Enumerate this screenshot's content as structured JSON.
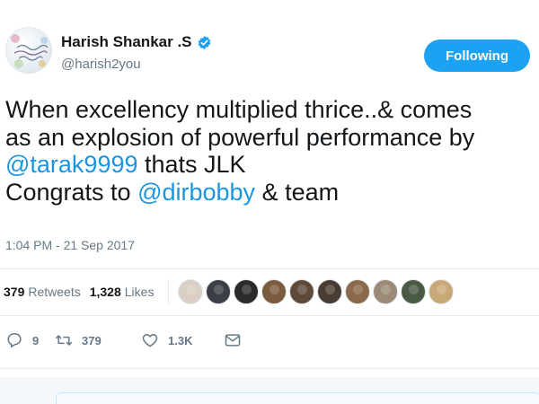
{
  "user": {
    "display_name": "Harish Shankar .S",
    "handle": "@harish2you",
    "avatar_icon": "floral-text-avatar",
    "verified_icon": "verified-badge-icon"
  },
  "follow_button": {
    "label": "Following"
  },
  "tweet": {
    "line1": "When excellency multiplied thrice..& comes",
    "line2": "as an explosion of powerful performance by",
    "line3_mention": "@tarak9999",
    "line3_rest": " thats JLK",
    "line4_pre": "Congrats to ",
    "line4_mention": "@dirbobby",
    "line4_post": " & team"
  },
  "timestamp": "1:04 PM - 21 Sep 2017",
  "stats": {
    "retweets_count": "379",
    "retweets_label": "Retweets",
    "likes_count": "1,328",
    "likes_label": "Likes"
  },
  "liker_avatars": [
    "#d9cfc4",
    "#3b3f45",
    "#2a2a2a",
    "#7a5b3d",
    "#5d4a3a",
    "#4b3c33",
    "#8a6a4a",
    "#9a8a76",
    "#4a5a44",
    "#c9a877"
  ],
  "actions": {
    "reply_count": "9",
    "retweet_count": "379",
    "like_count": "1.3K"
  },
  "colors": {
    "accent": "#1da1f2",
    "mention": "#1b95e0",
    "muted": "#657786"
  }
}
